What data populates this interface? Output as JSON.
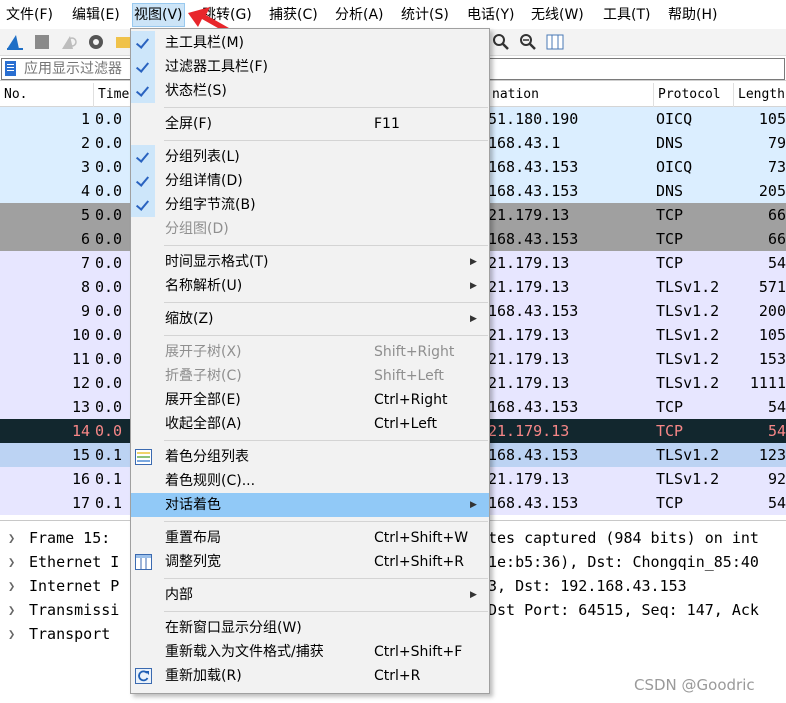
{
  "menubar": {
    "items": [
      {
        "label": "文件(F)"
      },
      {
        "label": "编辑(E)"
      },
      {
        "label": "视图(V)"
      },
      {
        "label": "跳转(G)"
      },
      {
        "label": "捕获(C)"
      },
      {
        "label": "分析(A)"
      },
      {
        "label": "统计(S)"
      },
      {
        "label": "电话(Y)"
      },
      {
        "label": "无线(W)"
      },
      {
        "label": "工具(T)"
      },
      {
        "label": "帮助(H)"
      }
    ]
  },
  "filter": {
    "placeholder": "应用显示过滤器"
  },
  "columns": {
    "no": "No.",
    "time": "Time",
    "destination": "nation",
    "protocol": "Protocol",
    "length": "Length"
  },
  "colors": {
    "oicq_dns": "#dbeeff",
    "tcp_gray": "#a0a0a0",
    "tcp_purple": "#e7e6ff",
    "selected_bg": "#12272e",
    "selected_fg": "#f78787",
    "highlight_row": "#bcd3f3",
    "menu_highlight": "#91c9f7"
  },
  "packets": [
    {
      "no": "1",
      "time": "0.0",
      "dst": "51.180.190",
      "proto": "OICQ",
      "len": "105",
      "style": "oicq_dns"
    },
    {
      "no": "2",
      "time": "0.0",
      "dst": "168.43.1",
      "proto": "DNS",
      "len": "79",
      "style": "oicq_dns"
    },
    {
      "no": "3",
      "time": "0.0",
      "dst": "168.43.153",
      "proto": "OICQ",
      "len": "73",
      "style": "oicq_dns"
    },
    {
      "no": "4",
      "time": "0.0",
      "dst": "168.43.153",
      "proto": "DNS",
      "len": "205",
      "style": "oicq_dns"
    },
    {
      "no": "5",
      "time": "0.0",
      "dst": "21.179.13",
      "proto": "TCP",
      "len": "66",
      "style": "tcp_gray"
    },
    {
      "no": "6",
      "time": "0.0",
      "dst": "168.43.153",
      "proto": "TCP",
      "len": "66",
      "style": "tcp_gray"
    },
    {
      "no": "7",
      "time": "0.0",
      "dst": "21.179.13",
      "proto": "TCP",
      "len": "54",
      "style": "tcp_purple"
    },
    {
      "no": "8",
      "time": "0.0",
      "dst": "21.179.13",
      "proto": "TLSv1.2",
      "len": "571",
      "style": "tcp_purple"
    },
    {
      "no": "9",
      "time": "0.0",
      "dst": "168.43.153",
      "proto": "TLSv1.2",
      "len": "200",
      "style": "tcp_purple"
    },
    {
      "no": "10",
      "time": "0.0",
      "dst": "21.179.13",
      "proto": "TLSv1.2",
      "len": "105",
      "style": "tcp_purple"
    },
    {
      "no": "11",
      "time": "0.0",
      "dst": "21.179.13",
      "proto": "TLSv1.2",
      "len": "153",
      "style": "tcp_purple"
    },
    {
      "no": "12",
      "time": "0.0",
      "dst": "21.179.13",
      "proto": "TLSv1.2",
      "len": "1111",
      "style": "tcp_purple"
    },
    {
      "no": "13",
      "time": "0.0",
      "dst": "168.43.153",
      "proto": "TCP",
      "len": "54",
      "style": "tcp_purple"
    },
    {
      "no": "14",
      "time": "0.0",
      "dst": "21.179.13",
      "proto": "TCP",
      "len": "54",
      "style": "selected"
    },
    {
      "no": "15",
      "time": "0.1",
      "dst": "168.43.153",
      "proto": "TLSv1.2",
      "len": "123",
      "style": "highlight_row"
    },
    {
      "no": "16",
      "time": "0.1",
      "dst": "21.179.13",
      "proto": "TLSv1.2",
      "len": "92",
      "style": "tcp_purple"
    },
    {
      "no": "17",
      "time": "0.1",
      "dst": "168.43.153",
      "proto": "TCP",
      "len": "54",
      "style": "tcp_purple"
    }
  ],
  "details": [
    {
      "left": "Frame 15:",
      "right": "tes captured (984 bits) on int"
    },
    {
      "left": "Ethernet I",
      "right": "1e:b5:36), Dst: Chongqin_85:40"
    },
    {
      "left": "Internet P",
      "right": "3, Dst: 192.168.43.153"
    },
    {
      "left": "Transmissi",
      "right": "Dst Port: 64515, Seq: 147, Ack"
    },
    {
      "left": "Transport",
      "right": ""
    }
  ],
  "view_menu": {
    "items": [
      {
        "label": "主工具栏(M)",
        "shortcut": "",
        "checked": true
      },
      {
        "label": "过滤器工具栏(F)",
        "shortcut": "",
        "checked": true
      },
      {
        "label": "状态栏(S)",
        "shortcut": "",
        "checked": true
      },
      {
        "label": "全屏(F)",
        "shortcut": "F11"
      },
      {
        "label": "分组列表(L)",
        "shortcut": "",
        "checked": true
      },
      {
        "label": "分组详情(D)",
        "shortcut": "",
        "checked": true
      },
      {
        "label": "分组字节流(B)",
        "shortcut": "",
        "checked": true
      },
      {
        "label": "分组图(D)",
        "shortcut": "",
        "disabled": true
      },
      {
        "label": "时间显示格式(T)",
        "shortcut": "",
        "submenu": true
      },
      {
        "label": "名称解析(U)",
        "shortcut": "",
        "submenu": true
      },
      {
        "label": "缩放(Z)",
        "shortcut": "",
        "submenu": true
      },
      {
        "label": "展开子树(X)",
        "shortcut": "Shift+Right",
        "disabled": true
      },
      {
        "label": "折叠子树(C)",
        "shortcut": "Shift+Left",
        "disabled": true
      },
      {
        "label": "展开全部(E)",
        "shortcut": "Ctrl+Right"
      },
      {
        "label": "收起全部(A)",
        "shortcut": "Ctrl+Left"
      },
      {
        "label": "着色分组列表",
        "shortcut": "",
        "icon": "colorize-icon"
      },
      {
        "label": "着色规则(C)...",
        "shortcut": ""
      },
      {
        "label": "对话着色",
        "shortcut": "",
        "submenu": true,
        "highlighted": true
      },
      {
        "label": "重置布局",
        "shortcut": "Ctrl+Shift+W"
      },
      {
        "label": "调整列宽",
        "shortcut": "Ctrl+Shift+R",
        "icon": "resize-columns-icon"
      },
      {
        "label": "内部",
        "shortcut": "",
        "submenu": true
      },
      {
        "label": "在新窗口显示分组(W)",
        "shortcut": ""
      },
      {
        "label": "重新载入为文件格式/捕获",
        "shortcut": "Ctrl+Shift+F"
      },
      {
        "label": "重新加载(R)",
        "shortcut": "Ctrl+R",
        "icon": "reload-icon"
      }
    ]
  },
  "watermark": "CSDN @Goodric"
}
